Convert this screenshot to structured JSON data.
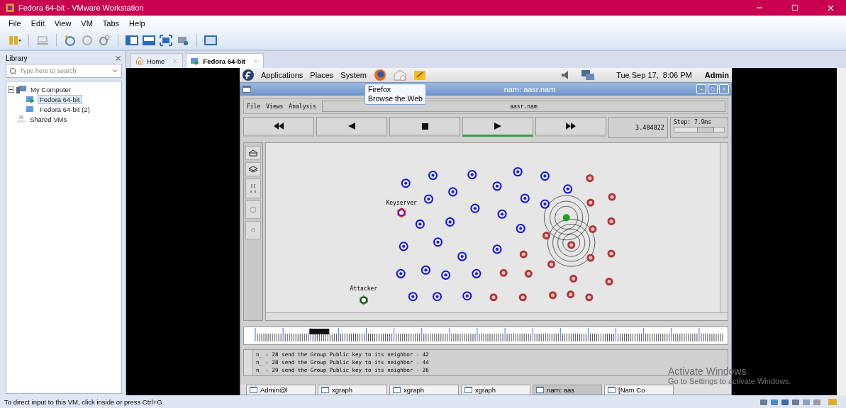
{
  "window": {
    "title": "Fedora 64-bit - VMware Workstation"
  },
  "menu": [
    "File",
    "Edit",
    "View",
    "VM",
    "Tabs",
    "Help"
  ],
  "library": {
    "title": "Library",
    "search": {
      "placeholder": "Type here to search"
    },
    "tree": [
      {
        "label": "My Computer",
        "selected": false,
        "expanded": true,
        "children": [
          {
            "label": "Fedora 64-bit",
            "selected": true
          },
          {
            "label": "Fedora 64-bit (2)",
            "selected": false
          }
        ]
      },
      {
        "label": "Shared VMs",
        "selected": false
      }
    ]
  },
  "tabs": [
    {
      "label": "Home",
      "selected": false
    },
    {
      "label": "Fedora 64-bit",
      "selected": true
    }
  ],
  "guest": {
    "panel": {
      "menus": [
        "Applications",
        "Places",
        "System"
      ],
      "clock": "Tue Sep 17,  8:06 PM",
      "user": "Admin"
    },
    "tooltip": [
      "Firefox",
      "Browse the Web"
    ],
    "nam": {
      "title": "nam: aasr.nam",
      "menu": [
        "File",
        "Views",
        "Analysis"
      ],
      "file": "aasr.nam",
      "controls": [
        {
          "kind": "rewind",
          "selected": false
        },
        {
          "kind": "back",
          "selected": false
        },
        {
          "kind": "stop",
          "selected": false
        },
        {
          "kind": "play",
          "selected": true
        },
        {
          "kind": "forward",
          "selected": false
        }
      ],
      "time": "3.484822",
      "step": {
        "label": "Step: 7.9ms",
        "level": 0.62
      },
      "node_labels": [
        {
          "kind": "keyserver",
          "text": "Keyserver"
        },
        {
          "kind": "attacker",
          "text": "Attacker"
        }
      ],
      "log": [
        "n_ - 28 send the Group Public key to its neighbor - 42",
        "n_ - 28 send the Group Public key to its neighbor - 44",
        "n_ - 29 send the Group Public key to its neighbor - 26"
      ]
    },
    "taskbar": [
      {
        "label": "Admin@l",
        "selected": false
      },
      {
        "label": "xgraph",
        "selected": false
      },
      {
        "label": "xgraph",
        "selected": false
      },
      {
        "label": "xgraph",
        "selected": false
      },
      {
        "label": "nam: aas",
        "selected": true
      },
      {
        "label": "[Nam Co",
        "selected": false
      }
    ]
  },
  "activation_notice": [
    "Activate Windows",
    "Go to Settings to activate Windows."
  ],
  "status_bar": "To direct input to this VM, click inside or press Ctrl+G."
}
